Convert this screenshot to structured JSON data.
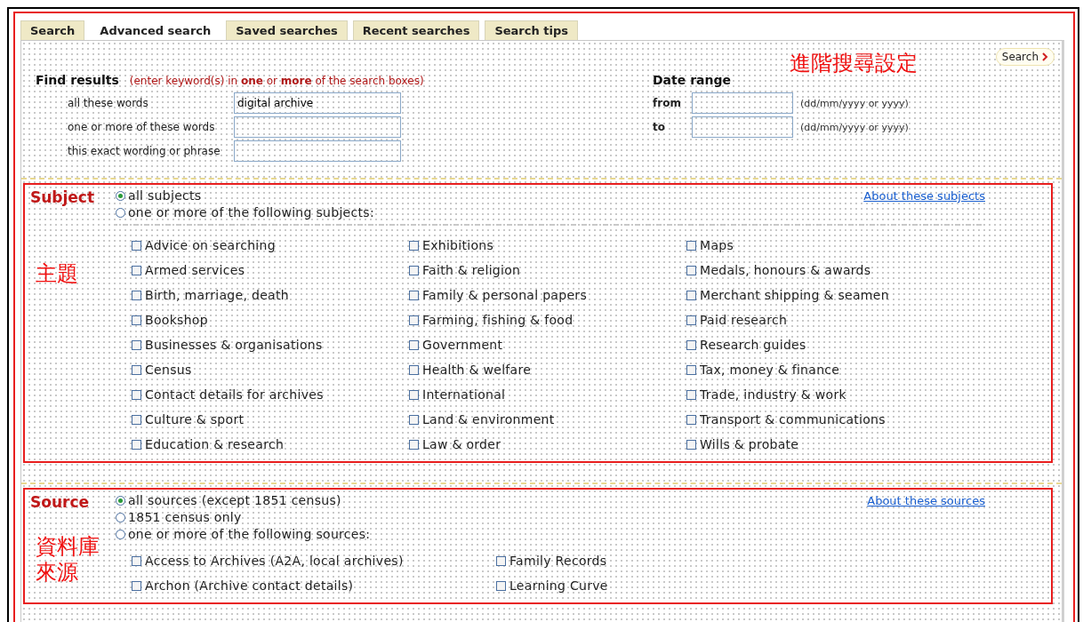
{
  "tabs": [
    {
      "label": "Search",
      "selected": false
    },
    {
      "label": "Advanced search",
      "selected": true
    },
    {
      "label": "Saved searches",
      "selected": false
    },
    {
      "label": "Recent searches",
      "selected": false
    },
    {
      "label": "Search tips",
      "selected": false
    }
  ],
  "annotation": "進階搜尋設定",
  "search_button": {
    "label": "Search"
  },
  "find_results": {
    "title": "Find results",
    "hint": "(enter keyword(s) in **one** or **more** of the search boxes)",
    "fields": [
      {
        "label": "all these words",
        "value": "digital archive"
      },
      {
        "label": "one or more of these words"
      },
      {
        "label": "this exact wording or phrase"
      }
    ]
  },
  "date_range": {
    "title": "Date range",
    "fields": [
      {
        "label": "from",
        "hint": "(dd/mm/yyyy or yyyy)"
      },
      {
        "label": "to",
        "hint": "(dd/mm/yyyy or yyyy)"
      }
    ]
  },
  "subject": {
    "title": "Subject",
    "annotation": "主題",
    "link": "About these subjects",
    "options": [
      {
        "label": "all subjects",
        "selected": true
      },
      {
        "label": "one or more of the following subjects:",
        "selected": false
      }
    ],
    "columns": [
      [
        {
          "label": "Advice on searching",
          "checked": false
        },
        {
          "label": "Armed services",
          "checked": false
        },
        {
          "label": "Birth, marriage, death",
          "checked": false
        },
        {
          "label": "Bookshop",
          "checked": false
        },
        {
          "label": "Businesses & organisations",
          "checked": false
        },
        {
          "label": "Census",
          "checked": false
        },
        {
          "label": "Contact details for archives",
          "checked": false
        },
        {
          "label": "Culture & sport",
          "checked": false
        },
        {
          "label": "Education & research",
          "checked": false
        }
      ],
      [
        {
          "label": "Exhibitions",
          "checked": false
        },
        {
          "label": "Faith & religion",
          "checked": false
        },
        {
          "label": "Family & personal papers",
          "checked": false
        },
        {
          "label": "Farming, fishing & food",
          "checked": false
        },
        {
          "label": "Government",
          "checked": false
        },
        {
          "label": "Health & welfare",
          "checked": false
        },
        {
          "label": "International",
          "checked": false
        },
        {
          "label": "Land & environment",
          "checked": false
        },
        {
          "label": "Law & order",
          "checked": false
        }
      ],
      [
        {
          "label": "Maps",
          "checked": false
        },
        {
          "label": "Medals, honours & awards",
          "checked": false
        },
        {
          "label": "Merchant shipping & seamen",
          "checked": false
        },
        {
          "label": "Paid research",
          "checked": false
        },
        {
          "label": "Research guides",
          "checked": false
        },
        {
          "label": "Tax, money & finance",
          "checked": false
        },
        {
          "label": "Trade, industry & work",
          "checked": false
        },
        {
          "label": "Transport & communications",
          "checked": false
        },
        {
          "label": "Wills & probate",
          "checked": false
        }
      ]
    ]
  },
  "source": {
    "title": "Source",
    "annotation": "資料庫來源",
    "link": "About these sources",
    "options": [
      {
        "label": "all sources (except 1851 census)",
        "selected": true
      },
      {
        "label": "1851 census only",
        "selected": false
      },
      {
        "label": "one or more of the following sources:",
        "selected": false
      }
    ],
    "columns": [
      [
        {
          "label": "Access to Archives (A2A, local archives)",
          "checked": false
        },
        {
          "label": "Archon (Archive contact details)",
          "checked": false
        }
      ],
      [
        {
          "label": "Family Records",
          "checked": false
        },
        {
          "label": "Learning Curve",
          "checked": false
        }
      ]
    ]
  }
}
